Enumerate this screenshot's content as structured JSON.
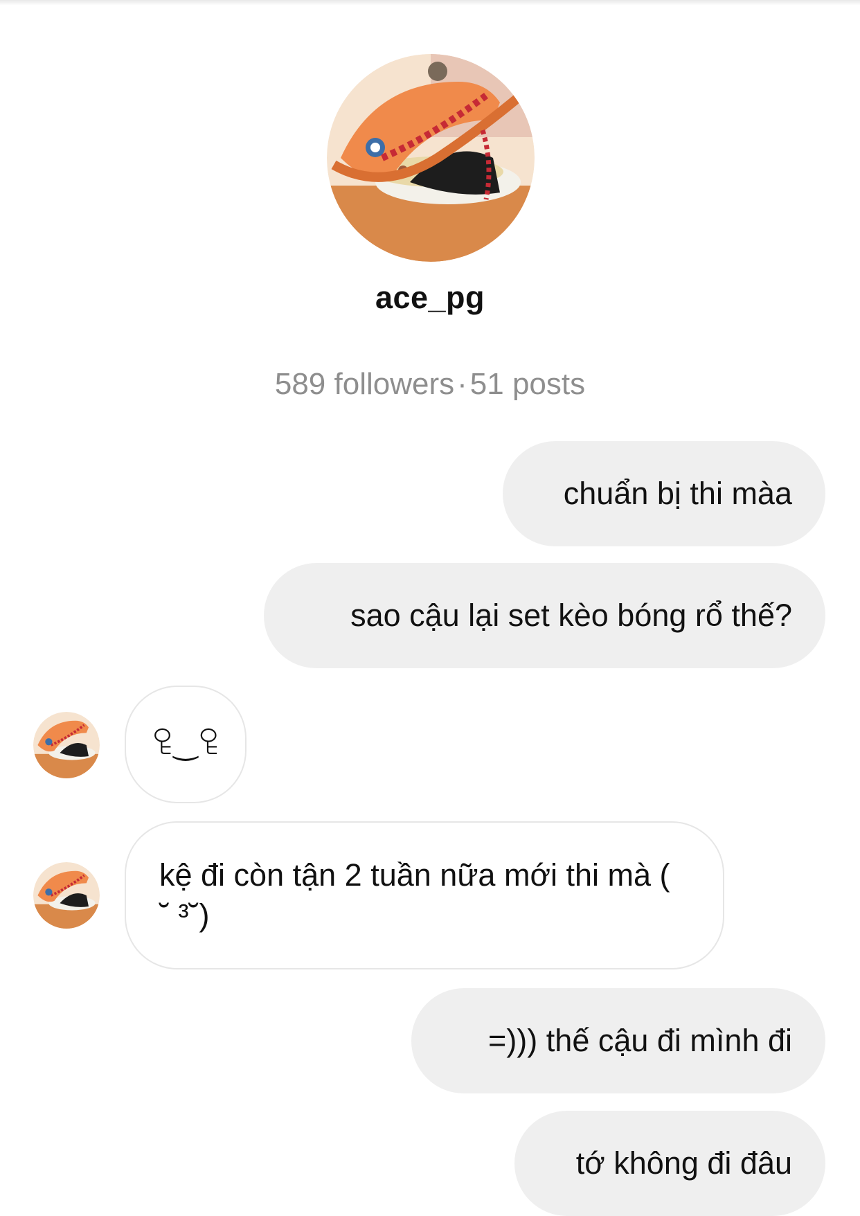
{
  "profile": {
    "username": "ace_pg",
    "followers": "589 followers",
    "separator": "·",
    "posts": "51 posts",
    "avatar_icon": "profile-photo-anime-hat"
  },
  "messages": [
    {
      "from": "me",
      "text": "chuẩn bị thi màa"
    },
    {
      "from": "me",
      "text": "sao cậu lại set kèo bóng rổ thế?"
    },
    {
      "from": "them",
      "text": "ꄗ‿ꄗ"
    },
    {
      "from": "them",
      "text": "kệ đi còn tận 2 tuần nữa mới thi mà ( ˘ ³˘)"
    },
    {
      "from": "me",
      "text": "=))) thế cậu đi mình đi"
    },
    {
      "from": "me",
      "text": "tớ không đi đâu"
    }
  ],
  "colors": {
    "outgoing_bubble": "#efefef",
    "incoming_border": "#e6e6e6",
    "stats_text": "#8e8e8e",
    "hat_orange": "#f08a4b"
  }
}
